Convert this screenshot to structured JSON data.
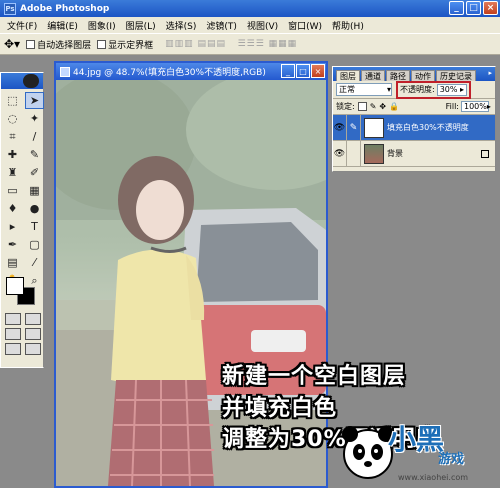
{
  "app": {
    "title": "Adobe Photoshop"
  },
  "menu": [
    "文件(F)",
    "编辑(E)",
    "图象(I)",
    "图层(L)",
    "选择(S)",
    "滤镜(T)",
    "视图(V)",
    "窗口(W)",
    "帮助(H)"
  ],
  "options": {
    "auto_select": "自动选择图层",
    "show_bounds": "显示定界框"
  },
  "document": {
    "title": "44.jpg @ 48.7%(填充白色30%不透明度,RGB)"
  },
  "layers_panel": {
    "tabs": [
      "图层",
      "通道",
      "路径",
      "动作",
      "历史记录"
    ],
    "blend_mode": "正常",
    "opacity_label": "不透明度:",
    "opacity_value": "30%",
    "lock_label": "锁定:",
    "fill_label": "Fill:",
    "fill_value": "100%",
    "layers": [
      {
        "name": "填充白色30%不透明度",
        "selected": true
      },
      {
        "name": "背景",
        "selected": false
      }
    ]
  },
  "caption": {
    "line1": "新建一个空白图层",
    "line2": "并填充白色",
    "line3": "调整为30%不透明度"
  },
  "watermark": {
    "brand": "小黑",
    "sub": "游戏",
    "url": "www.xiaohei.com"
  },
  "colors": {
    "title_blue": "#1c55c4",
    "selected_layer": "#316ac5",
    "highlight_red": "#c0202a"
  }
}
